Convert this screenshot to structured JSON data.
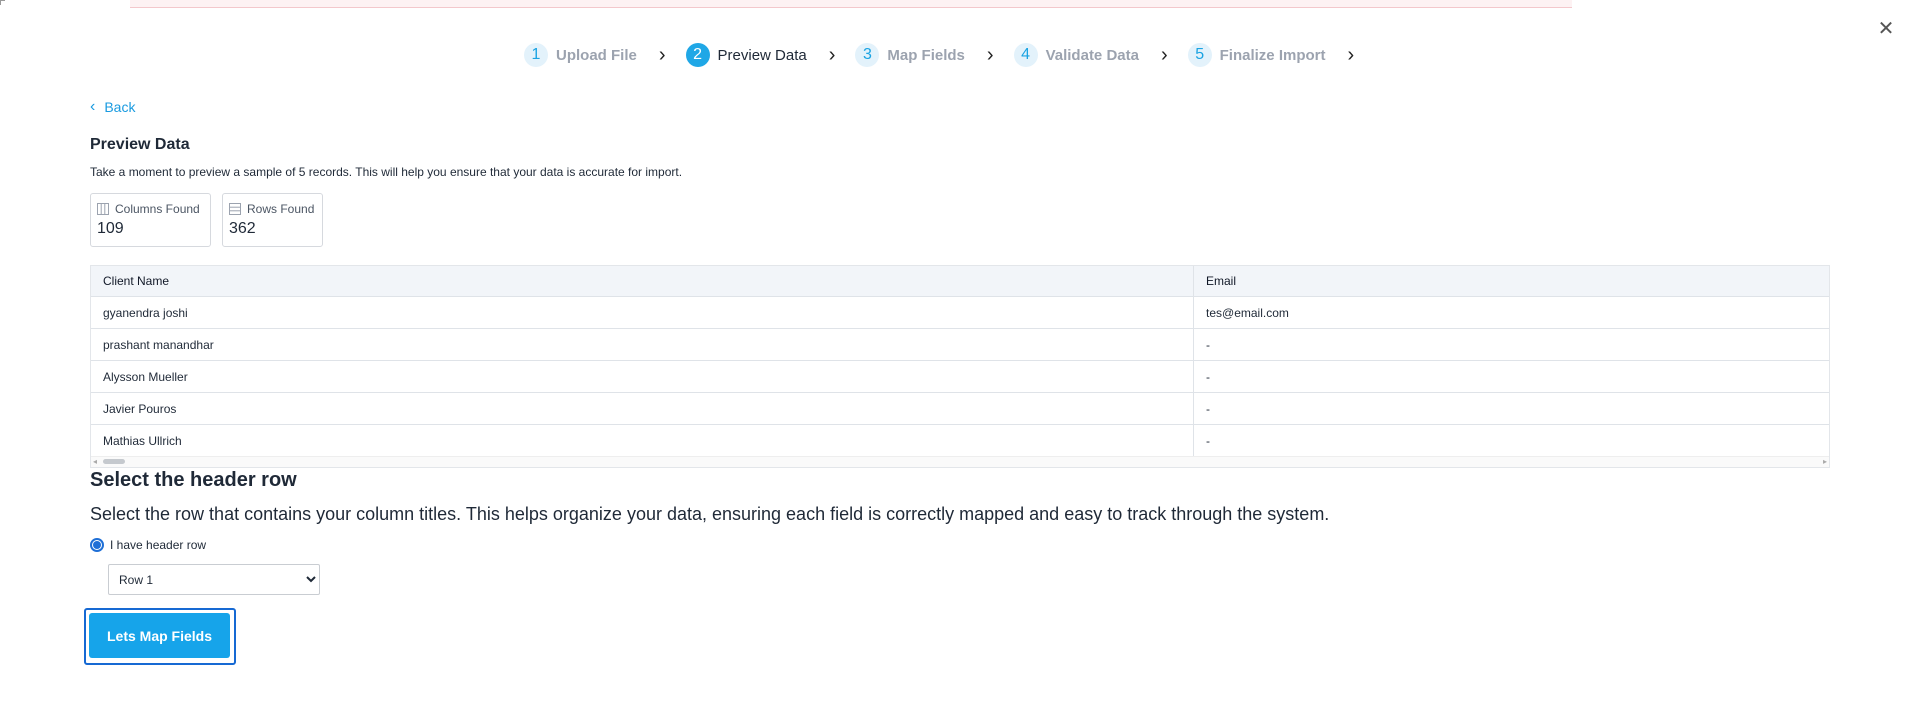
{
  "stepper": {
    "steps": [
      {
        "number": "1",
        "label": "Upload File"
      },
      {
        "number": "2",
        "label": "Preview Data"
      },
      {
        "number": "3",
        "label": "Map Fields"
      },
      {
        "number": "4",
        "label": "Validate Data"
      },
      {
        "number": "5",
        "label": "Finalize Import"
      }
    ],
    "active_index": 1
  },
  "icons": {
    "close": "close-icon",
    "back": "chevron-left-icon",
    "step_separator": "chevron-right-icon",
    "columns": "columns-icon",
    "rows": "rows-icon"
  },
  "back": {
    "label": "Back"
  },
  "preview": {
    "title": "Preview Data",
    "description": "Take a moment to preview a sample of 5 records. This will help you ensure that your data is accurate for import."
  },
  "stats": {
    "columns": {
      "label": "Columns Found",
      "value": "109"
    },
    "rows": {
      "label": "Rows Found",
      "value": "362"
    }
  },
  "table": {
    "headers": [
      "Client Name",
      "Email"
    ],
    "rows": [
      [
        "gyanendra joshi",
        "tes@email.com"
      ],
      [
        "prashant manandhar",
        "-"
      ],
      [
        "Alysson Mueller",
        "-"
      ],
      [
        "Javier Pouros",
        "-"
      ],
      [
        "Mathias Ullrich",
        "-"
      ]
    ]
  },
  "header_row": {
    "title": "Select the header row",
    "description": "Select the row that contains your column titles. This helps organize your data, ensuring each field is correctly mapped and easy to track through the system.",
    "radio_label": "I have header row",
    "selected_option": "Row 1"
  },
  "actions": {
    "primary_label": "Lets Map Fields"
  },
  "colors": {
    "accent": "#1fa7e6",
    "primary_button": "#16a4ea",
    "focus_outline": "#1669d3"
  }
}
